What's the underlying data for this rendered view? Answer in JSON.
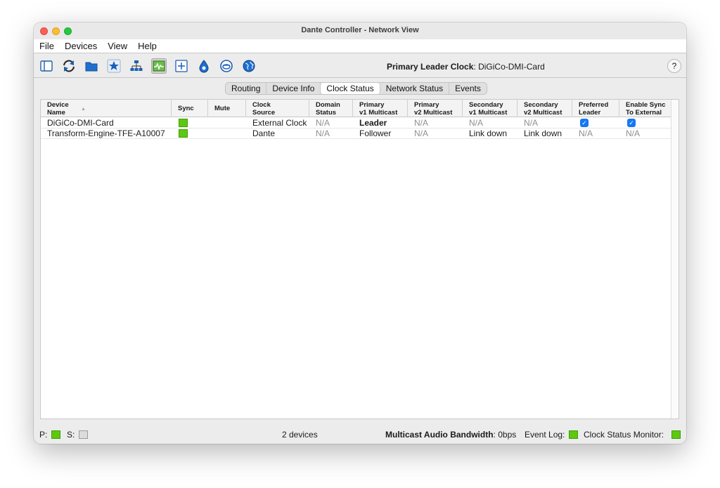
{
  "window": {
    "title": "Dante Controller - Network View"
  },
  "menu": {
    "items": [
      "File",
      "Devices",
      "View",
      "Help"
    ]
  },
  "toolbar": {
    "icons": [
      "sidebar-panel-icon",
      "refresh-icon",
      "folder-icon",
      "star-icon",
      "network-tree-icon",
      "clock-status-icon",
      "add-grid-icon",
      "dante-drop-icon",
      "dvs-icon",
      "globe-icon"
    ],
    "primary_clock_label": "Primary Leader Clock",
    "primary_clock_value": "DiGiCo-DMI-Card",
    "help_label": "?"
  },
  "tabs": [
    "Routing",
    "Device Info",
    "Clock Status",
    "Network Status",
    "Events"
  ],
  "selected_tab": "Clock Status",
  "table": {
    "columns": [
      {
        "line1": "Device",
        "line2": "Name"
      },
      {
        "line1": "Sync",
        "line2": ""
      },
      {
        "line1": "Mute",
        "line2": ""
      },
      {
        "line1": "Clock",
        "line2": "Source"
      },
      {
        "line1": "Domain",
        "line2": "Status"
      },
      {
        "line1": "Primary",
        "line2": "v1 Multicast"
      },
      {
        "line1": "Primary",
        "line2": "v2 Multicast"
      },
      {
        "line1": "Secondary",
        "line2": "v1 Multicast"
      },
      {
        "line1": "Secondary",
        "line2": "v2 Multicast"
      },
      {
        "line1": "Preferred",
        "line2": "Leader"
      },
      {
        "line1": "Enable Sync",
        "line2": "To External"
      }
    ],
    "rows": [
      {
        "device_name": "DiGiCo-DMI-Card",
        "sync": "green",
        "clock_source": "External Clock",
        "domain_status": "N/A",
        "primary_v1": "Leader",
        "primary_v2": "N/A",
        "secondary_v1": "N/A",
        "secondary_v2": "N/A",
        "preferred_leader": true,
        "enable_sync_to_external": true
      },
      {
        "device_name": "Transform-Engine-TFE-A10007",
        "sync": "green",
        "clock_source": "Dante",
        "domain_status": "N/A",
        "primary_v1": "Follower",
        "primary_v2": "N/A",
        "secondary_v1": "Link down",
        "secondary_v2": "Link down",
        "preferred_leader": "N/A",
        "enable_sync_to_external": "N/A"
      }
    ]
  },
  "status": {
    "p_label": "P:",
    "s_label": "S:",
    "devices_count": "2 devices",
    "bandwidth_label": "Multicast Audio Bandwidth",
    "bandwidth_value": "0bps",
    "event_log_label": "Event Log:",
    "clock_monitor_label": "Clock Status Monitor:"
  },
  "colors": {
    "status_green": "#5dc80f",
    "checkbox_blue": "#1677f2"
  }
}
